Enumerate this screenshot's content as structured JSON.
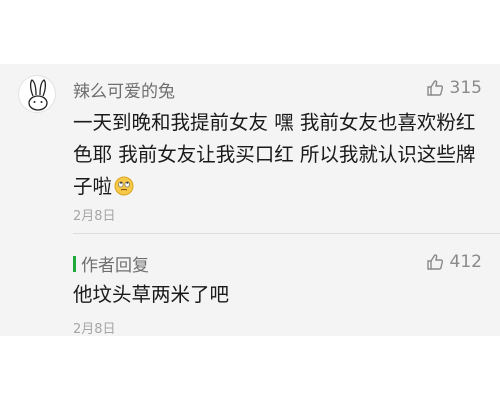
{
  "comment": {
    "nickname": "辣么可爱的兔",
    "like_count": "315",
    "content": "一天到晚和我提前女友 嘿 我前女友也喜欢粉红色耶 我前女友让我买口红 所以我就认识这些牌子啦",
    "emoji": "eye-roll-emoji",
    "date": "2月8日"
  },
  "reply": {
    "label": "作者回复",
    "like_count": "412",
    "content": "他坟头草两米了吧",
    "date": "2月8日"
  },
  "colors": {
    "accent_green": "#1ea83b",
    "card_bg": "#f4f4f4"
  }
}
